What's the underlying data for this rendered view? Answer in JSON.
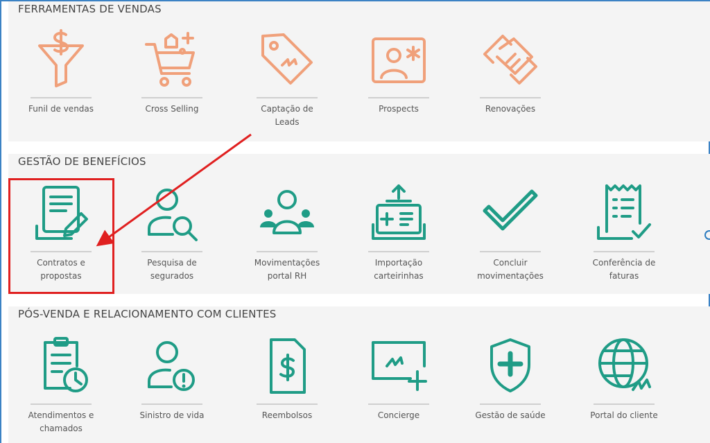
{
  "sections": [
    {
      "title": "FERRAMENTAS DE VENDAS",
      "items": [
        {
          "label": "Funil de vendas",
          "icon": "funnel-dollar-icon"
        },
        {
          "label": "Cross Selling",
          "icon": "shopping-cart-icon"
        },
        {
          "label": "Captação de Leads",
          "icon": "price-tag-icon"
        },
        {
          "label": "Prospects",
          "icon": "id-card-icon"
        },
        {
          "label": "Renovações",
          "icon": "handshake-icon"
        }
      ]
    },
    {
      "title": "GESTÃO DE BENEFÍCIOS",
      "items": [
        {
          "label": "Contratos e propostas",
          "icon": "contract-edit-icon"
        },
        {
          "label": "Pesquisa de segurados",
          "icon": "user-search-icon"
        },
        {
          "label": "Movimentações portal RH",
          "icon": "group-users-icon"
        },
        {
          "label": "Importação carteirinhas",
          "icon": "upload-card-icon"
        },
        {
          "label": "Concluir movimentações",
          "icon": "checkmark-icon"
        },
        {
          "label": "Conferência de faturas",
          "icon": "invoice-check-icon"
        }
      ]
    },
    {
      "title": "PÓS-VENDA E RELACIONAMENTO COM CLIENTES",
      "items": [
        {
          "label": "Atendimentos e chamados",
          "icon": "clipboard-clock-icon"
        },
        {
          "label": "Sinistro de vida",
          "icon": "user-alert-icon"
        },
        {
          "label": "Reembolsos",
          "icon": "dollar-document-icon"
        },
        {
          "label": "Concierge",
          "icon": "screen-plus-icon"
        },
        {
          "label": "Gestão de saúde",
          "icon": "shield-plus-icon"
        },
        {
          "label": "Portal do cliente",
          "icon": "globe-icon"
        }
      ]
    }
  ],
  "colors": {
    "sales": "#f0a07a",
    "benefits": "#1f9c86",
    "annotation": "#e02020"
  }
}
